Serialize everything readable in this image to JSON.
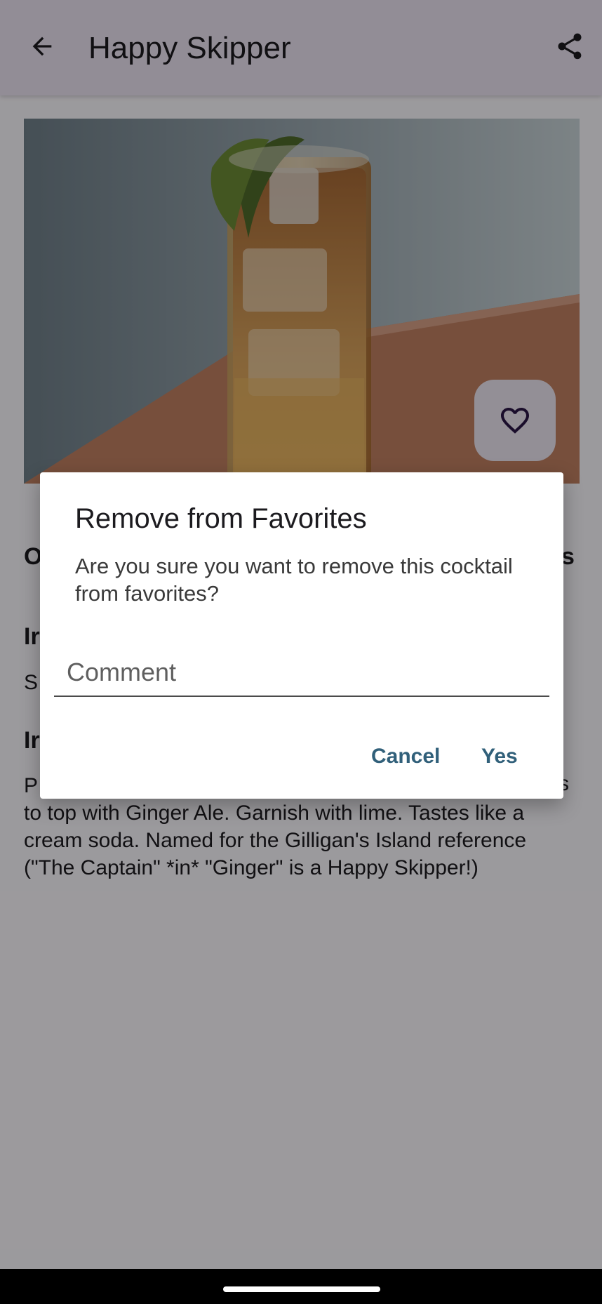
{
  "app_bar": {
    "title": "Happy Skipper",
    "back_icon": "arrow-left-icon",
    "share_icon": "share-icon"
  },
  "hero": {
    "favorite_icon": "heart-outline-icon"
  },
  "content": {
    "partial_heading_1": "O",
    "partial_heading_1_end": "s",
    "ingredients_heading": "Ir",
    "ingredients_partial": "S",
    "instructions_heading": "Ir",
    "instructions_lines": [
      "P",
      "to top with Ginger Ale. Garnish with lime. Tastes like a",
      "cream soda. Named for the Gilligan's Island reference",
      "(\"The Captain\" *in* \"Ginger\" is a Happy Skipper!)"
    ],
    "instructions_line1_end": "s"
  },
  "dialog": {
    "title": "Remove from Favorites",
    "message": "Are you sure you want to remove this cocktail from favorites?",
    "comment_placeholder": "Comment",
    "cancel_label": "Cancel",
    "yes_label": "Yes"
  },
  "colors": {
    "app_bar_bg": "#ece4f2",
    "dialog_button": "#31607a",
    "heart": "#2b1646"
  }
}
